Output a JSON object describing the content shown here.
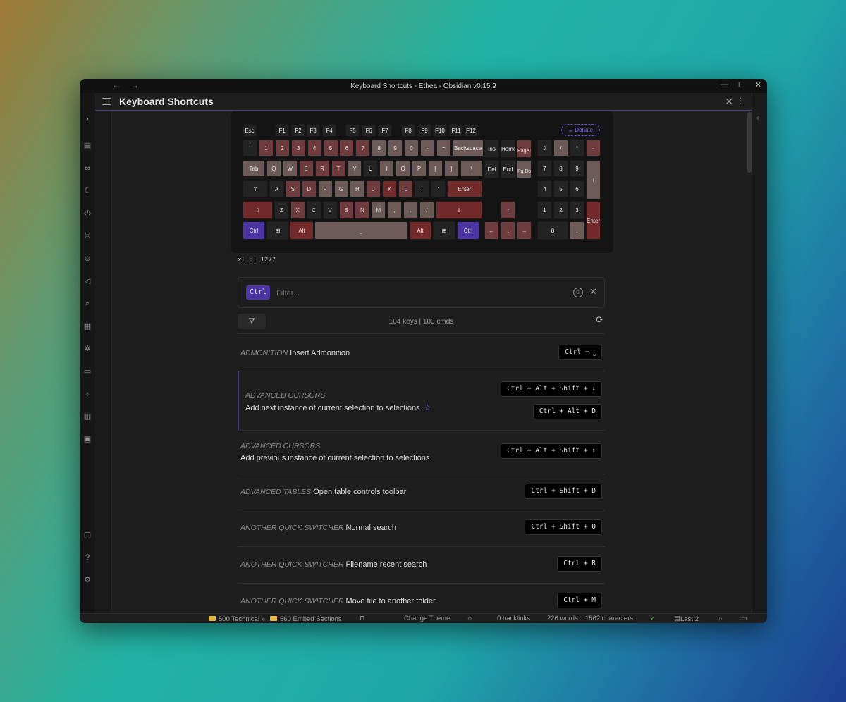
{
  "window": {
    "title": "Keyboard Shortcuts - Ethea - Obsidian v0.15.9",
    "nav_back": "←",
    "nav_forward": "→",
    "controls": [
      "—",
      "☐",
      "✕"
    ]
  },
  "header": {
    "title": "Keyboard Shortcuts",
    "close": "✕",
    "more": "⋮"
  },
  "keyboard": {
    "donate_label": "Donate",
    "fn_row": [
      "Esc",
      "F1",
      "F2",
      "F3",
      "F4",
      "F5",
      "F6",
      "F7",
      "F8",
      "F9",
      "F10",
      "F11",
      "F12"
    ],
    "row1": [
      "`",
      "1",
      "2",
      "3",
      "4",
      "5",
      "6",
      "7",
      "8",
      "9",
      "0",
      "-",
      "=",
      "Backspace"
    ],
    "row2": [
      "Tab",
      "Q",
      "W",
      "E",
      "R",
      "T",
      "Y",
      "U",
      "I",
      "O",
      "P",
      "[",
      "]",
      "\\"
    ],
    "row3": [
      "⇪",
      "A",
      "S",
      "D",
      "F",
      "G",
      "H",
      "J",
      "K",
      "L",
      ";",
      "'",
      "Enter"
    ],
    "row4": [
      "⇧",
      "Z",
      "X",
      "C",
      "V",
      "B",
      "N",
      "M",
      ",",
      ".",
      "/",
      "⇧"
    ],
    "row5": [
      "Ctrl",
      "⊞",
      "Alt",
      "⎵",
      "Alt",
      "⊞",
      "Ctrl"
    ],
    "nav_keys": [
      "Ins",
      "Home",
      "Page Up",
      "Del",
      "End",
      "Pg Down"
    ],
    "arrows": [
      "↑",
      "←",
      "↓",
      "→"
    ],
    "numpad": [
      "⇳",
      "/",
      "*",
      "-",
      "7",
      "8",
      "9",
      "+",
      "4",
      "5",
      "6",
      "1",
      "2",
      "3",
      "Enter",
      "0",
      "."
    ]
  },
  "xl_label": "xl :: 1277",
  "filter": {
    "modifier": "Ctrl",
    "placeholder": "Filter...",
    "clear": "✕"
  },
  "toolbar": {
    "filter_icon": "⛛",
    "counts": "104 keys | 103 cmds",
    "refresh": "⟳"
  },
  "commands": [
    {
      "plugin": "ADMONITION",
      "name": "Insert Admonition",
      "hotkeys": [
        "Ctrl + ⎵"
      ]
    },
    {
      "plugin": "ADVANCED CURSORS",
      "name": "Add next instance of current selection to selections",
      "hotkeys": [
        "Ctrl + Alt + Shift + ↓",
        "Ctrl + Alt + D"
      ],
      "starred": "☆"
    },
    {
      "plugin": "ADVANCED CURSORS",
      "name": "Add previous instance of current selection to selections",
      "hotkeys": [
        "Ctrl + Alt + Shift + ↑"
      ]
    },
    {
      "plugin": "ADVANCED TABLES",
      "name": "Open table controls toolbar",
      "hotkeys": [
        "Ctrl + Shift + D"
      ]
    },
    {
      "plugin": "ANOTHER QUICK SWITCHER",
      "name": "Normal search",
      "hotkeys": [
        "Ctrl + Shift + O"
      ]
    },
    {
      "plugin": "ANOTHER QUICK SWITCHER",
      "name": "Filename recent search",
      "hotkeys": [
        "Ctrl + R"
      ]
    },
    {
      "plugin": "ANOTHER QUICK SWITCHER",
      "name": "Move file to another folder",
      "hotkeys": [
        "Ctrl + M"
      ]
    }
  ],
  "statusbar": {
    "folder1": "500 Technical »",
    "folder2": "560 Embed Sections",
    "change_theme": "Change Theme",
    "backlinks": "0 backlinks",
    "words": "226 words",
    "characters": "1562 characters",
    "last": "Last 2"
  }
}
